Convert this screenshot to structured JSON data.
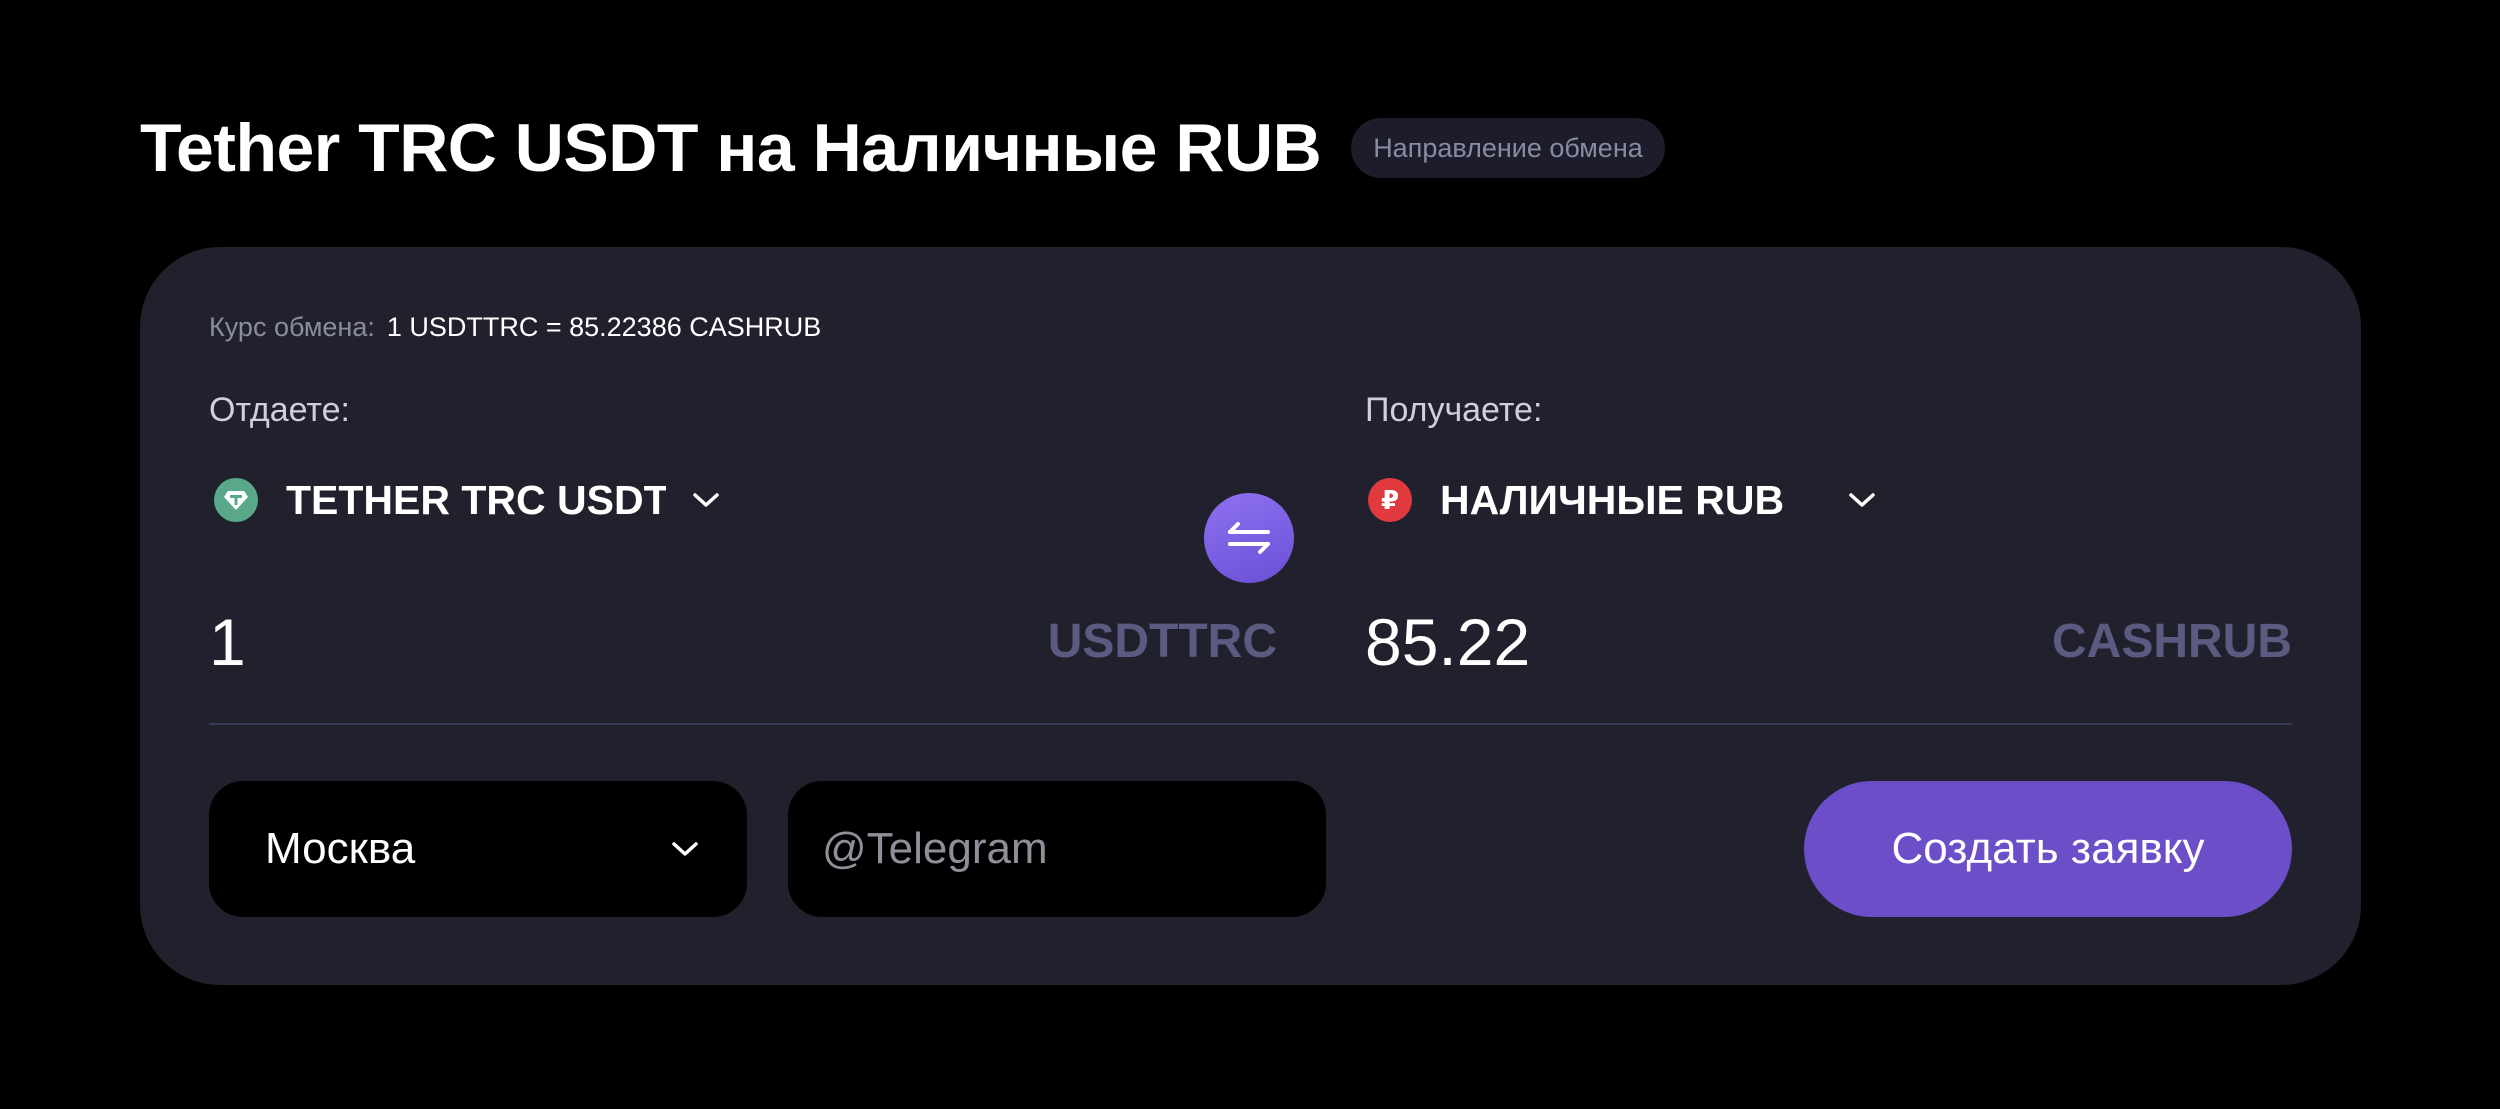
{
  "header": {
    "title": "Tether TRC USDT на Наличные RUB",
    "badge": "Направление обмена"
  },
  "rate": {
    "label": "Курс обмена:",
    "value": "1 USDTTRC = 85.22386 CASHRUB"
  },
  "give": {
    "label": "Отдаете:",
    "currency_name": "TETHER TRC USDT",
    "currency_icon": "tether-icon",
    "amount": "1",
    "code": "USDTTRC"
  },
  "receive": {
    "label": "Получаете:",
    "currency_name": "НАЛИЧНЫЕ RUB",
    "currency_icon": "ruble-icon",
    "currency_icon_glyph": "₽",
    "amount": "85.22",
    "code": "CASHRUB"
  },
  "city": {
    "selected": "Москва"
  },
  "telegram": {
    "placeholder": "@Telegram",
    "value": ""
  },
  "submit": {
    "label": "Создать заявку"
  },
  "colors": {
    "background": "#000000",
    "card": "#21212e",
    "accent": "#6b4ec8",
    "muted_code": "#5c5a80",
    "tether": "#5aa88a",
    "rub": "#e0393e"
  }
}
